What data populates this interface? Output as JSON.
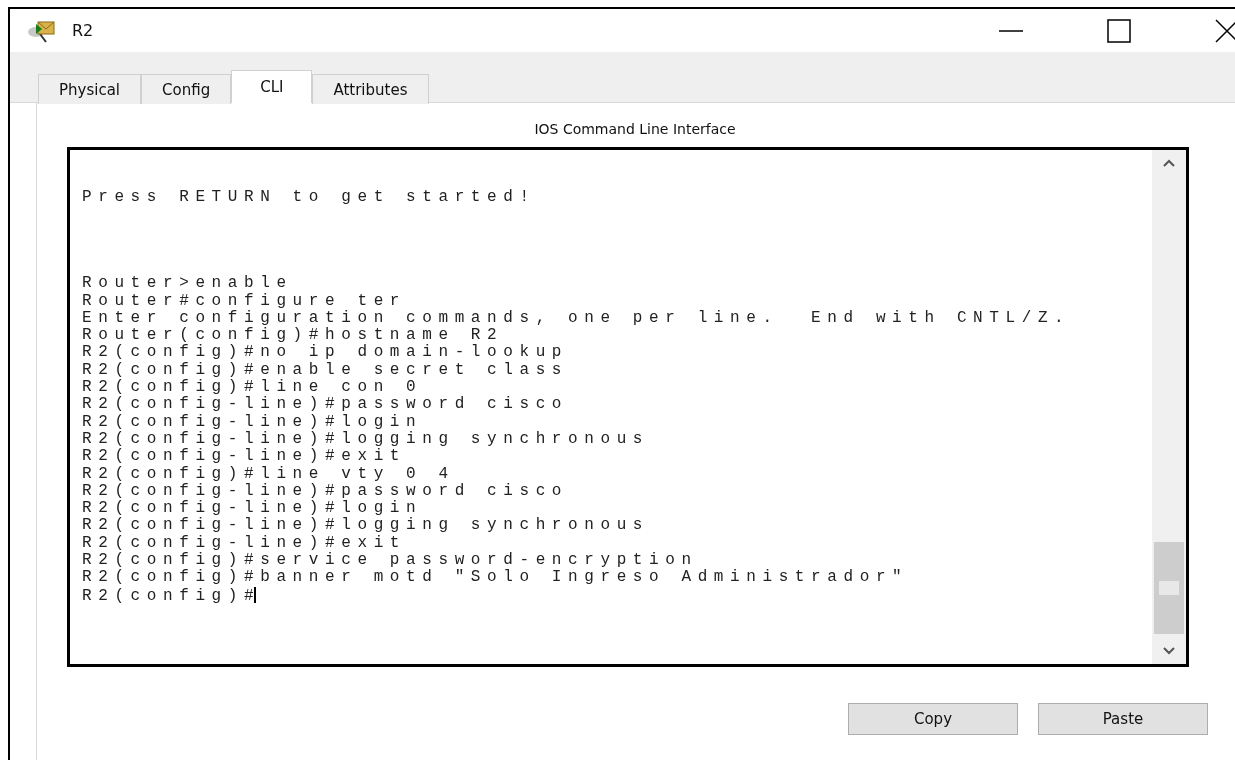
{
  "window": {
    "title": "R2"
  },
  "tabs": [
    {
      "label": "Physical",
      "selected": false
    },
    {
      "label": "Config",
      "selected": false
    },
    {
      "label": "CLI",
      "selected": true
    },
    {
      "label": "Attributes",
      "selected": false
    }
  ],
  "panel_title": "IOS Command Line Interface",
  "terminal": {
    "blocks": [
      [
        "Press RETURN to get started!"
      ],
      [
        "Router>enable",
        "Router#configure ter",
        "Enter configuration commands, one per line.  End with CNTL/Z.",
        "Router(config)#hostname R2",
        "R2(config)#no ip domain-lookup",
        "R2(config)#enable secret class",
        "R2(config)#line con 0",
        "R2(config-line)#password cisco",
        "R2(config-line)#login",
        "R2(config-line)#logging synchronous",
        "R2(config-line)#exit",
        "R2(config)#line vty 0 4",
        "R2(config-line)#password cisco",
        "R2(config-line)#login",
        "R2(config-line)#logging synchronous",
        "R2(config-line)#exit",
        "R2(config)#service password-encryption",
        "R2(config)#banner motd \"Solo Ingreso Administrador\"",
        "R2(config)#"
      ]
    ]
  },
  "buttons": [
    "Copy",
    "Paste"
  ]
}
